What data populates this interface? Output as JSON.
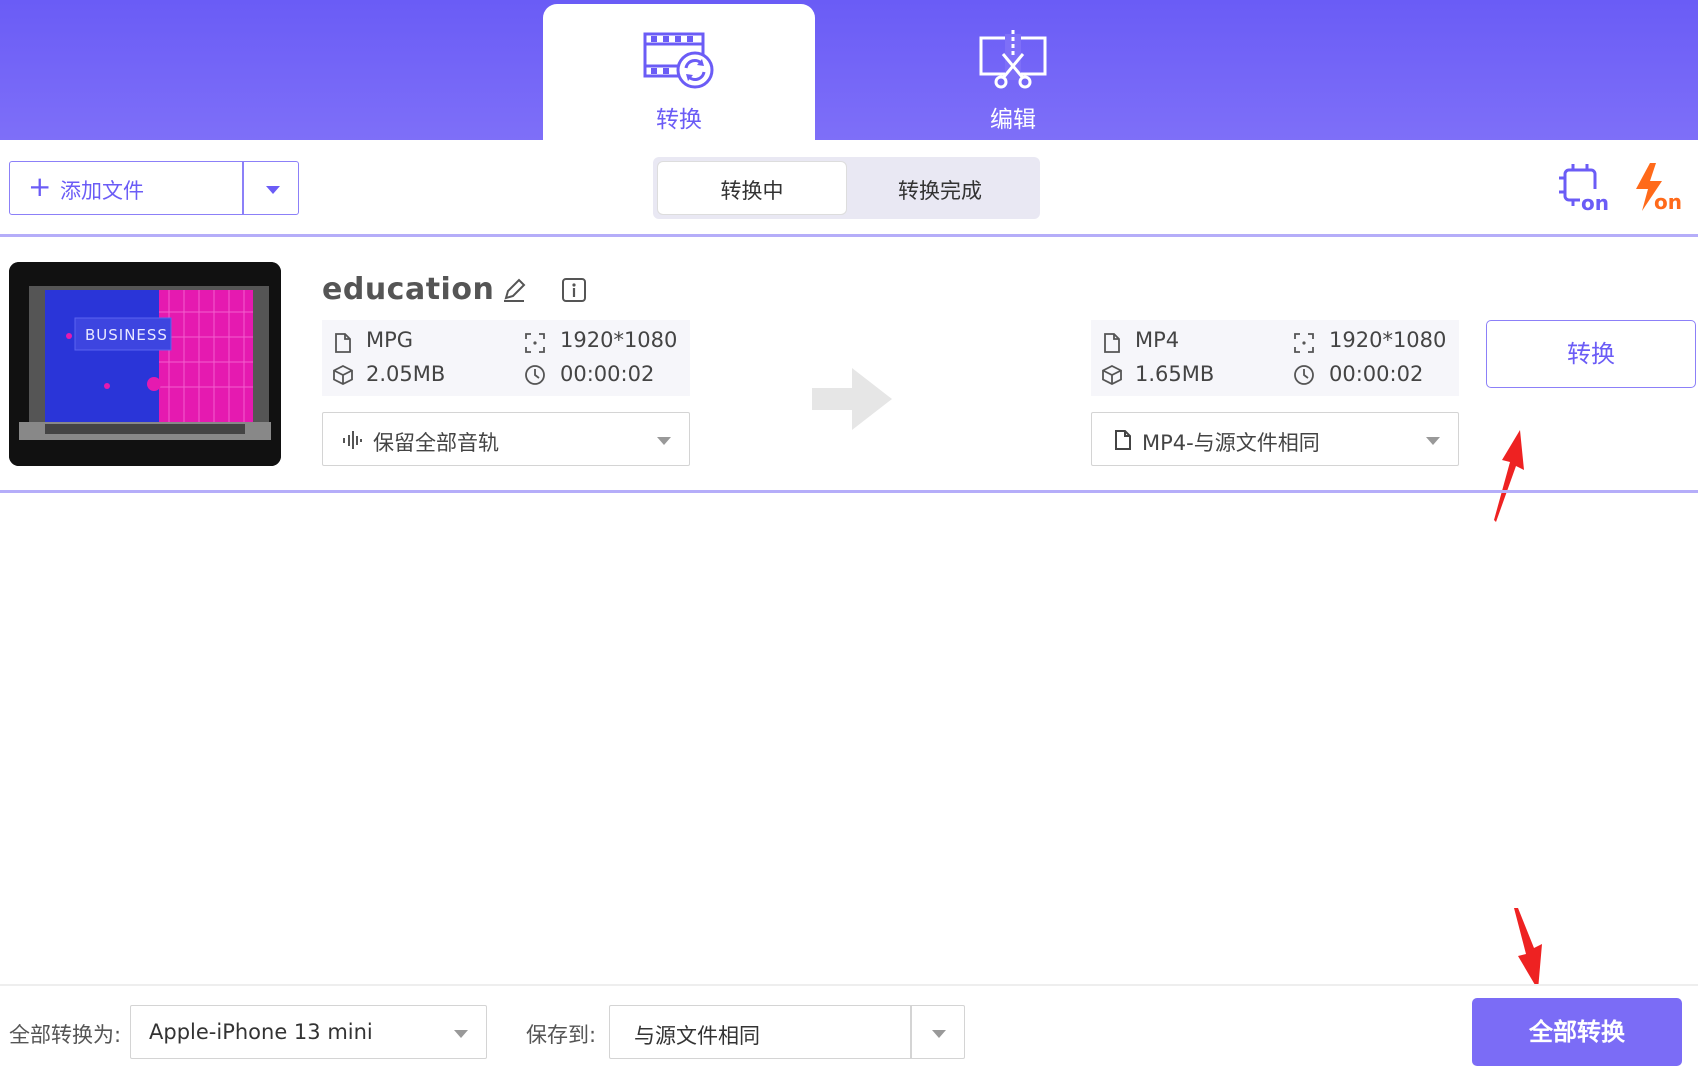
{
  "header": {
    "tabs": [
      {
        "label": "转换",
        "icon": "video-convert-icon",
        "active": true
      },
      {
        "label": "编辑",
        "icon": "scissors-edit-icon",
        "active": false
      }
    ],
    "colors": {
      "accent": "#6b5cf6",
      "header_bg": "#7163f7"
    }
  },
  "toolbar": {
    "add_file_label": "添加文件",
    "segments": [
      {
        "label": "转换中",
        "active": true
      },
      {
        "label": "转换完成",
        "active": false
      }
    ],
    "hw_accel_icon": "cpu-on-icon",
    "high_speed_icon": "flash-on-icon",
    "hw_accel_text": "on",
    "high_speed_text": "on"
  },
  "file": {
    "name": "education",
    "thumbnail_text": "BUSINESS",
    "source": {
      "format": "MPG",
      "resolution": "1920*1080",
      "size": "2.05MB",
      "duration": "00:00:02"
    },
    "target": {
      "format": "MP4",
      "resolution": "1920*1080",
      "size": "1.65MB",
      "duration": "00:00:02"
    },
    "audio_track": "保留全部音轨",
    "output_format": "MP4-与源文件相同",
    "convert_label": "转换"
  },
  "bottom": {
    "convert_all_to_label": "全部转换为:",
    "convert_all_to_value": "Apple-iPhone 13 mini",
    "save_to_label": "保存到:",
    "save_to_value": "与源文件相同",
    "convert_all_button": "全部转换"
  }
}
